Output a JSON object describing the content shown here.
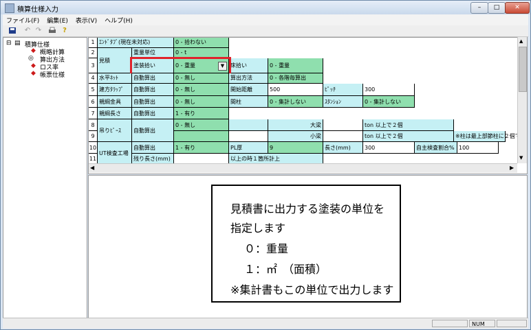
{
  "window": {
    "title": "積算仕様入力",
    "minimize": "–",
    "maximize": "□",
    "close": "✕"
  },
  "menu": [
    "ファイル(F)",
    "編集(E)",
    "表示(V)",
    "ヘルプ(H)"
  ],
  "toolbar": {
    "icons": [
      "save-icon",
      "undo-icon",
      "redo-icon",
      "print-icon",
      "help-icon"
    ]
  },
  "tree": {
    "root": "積算仕様",
    "children": [
      "概略計算",
      "算出方法",
      "ロス率",
      "帳票仕様"
    ]
  },
  "grid": {
    "r1": {
      "num": "1",
      "label": "ｴﾝﾄﾞﾀﾌﾞ(現在未対応)",
      "value": "0 - 拾わない"
    },
    "r2": {
      "num": "2",
      "label": "重量単位",
      "value": "0 - t"
    },
    "r3": {
      "num": "3",
      "group": "見積",
      "label": "塗装拾い",
      "value": "0 - 重量",
      "label2": "床拾い",
      "value2": "0 - 重量"
    },
    "r4": {
      "num": "4",
      "group": "水平ﾈｯﾄ",
      "label": "自動算出",
      "value": "0 - 無し",
      "label2": "算出方法",
      "value2": "0 - 各階毎算出"
    },
    "r5": {
      "num": "5",
      "group": "建方ﾀﾗｯﾌﾟ",
      "label": "自動算出",
      "value": "0 - 無し",
      "label2": "開始距離",
      "value2": "500",
      "label3": "ﾋﾟｯﾁ",
      "value3": "300"
    },
    "r6": {
      "num": "6",
      "group": "親綱金具",
      "label": "自動算出",
      "value": "0 - 無し",
      "label2": "間柱",
      "value2": "0 - 集計しない",
      "label3": "ｽﾀﾝｼｮﾝ",
      "value3": "0 - 集計しない"
    },
    "r7": {
      "num": "7",
      "group": "親綱長さ",
      "label": "自動算出",
      "value": "1 - 有り"
    },
    "r8": {
      "num": "8",
      "group": "吊りﾋﾟｰｽ",
      "label": "自動算出",
      "value": "0 - 無し",
      "label2": "大梁",
      "value2": "ton 以上で２個"
    },
    "r9": {
      "num": "9",
      "label2": "小梁",
      "value2": "ton 以上で２個",
      "note": "※柱は最上部節柱に２個で算出"
    },
    "r10": {
      "num": "10",
      "group": "UT検査工場",
      "label": "自動算出",
      "value": "1 - 有り",
      "label2": "PL厚",
      "value2": "9",
      "label3": "長さ(mm)",
      "value3": "300",
      "label4": "自主検査割合%",
      "value4": "100"
    },
    "r11": {
      "num": "11",
      "label": "残り長さ(mm)",
      "value2": "以上の時１箇所計上"
    }
  },
  "help": {
    "line1": "見積書に出力する塗装の単位を",
    "line2": "指定します",
    "line3": "０：重量",
    "line4": "１：㎡　（面積）",
    "line5": "※集計書もこの単位で出力します"
  },
  "status": {
    "num": "NUM"
  },
  "highlight_color": "#e0232b"
}
